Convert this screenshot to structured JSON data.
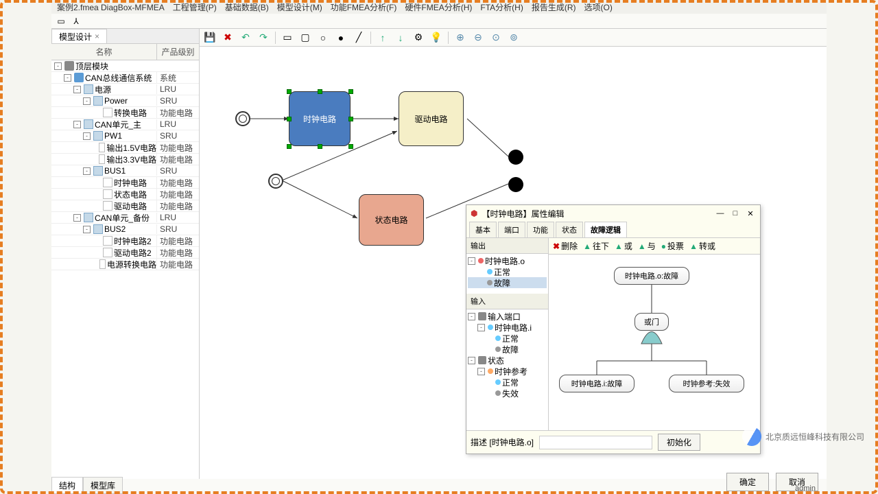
{
  "title_fragment": "案例2.fmea   DiagBox-MFMEA",
  "menus": [
    "工程管理(P)",
    "基础数据(B)",
    "模型设计(M)",
    "功能FMEA分析(F)",
    "硬件FMEA分析(H)",
    "FTA分析(H)",
    "报告生成(R)",
    "选项(O)"
  ],
  "model_tab": "模型设计",
  "tree_headers": {
    "name": "名称",
    "level": "产品级别"
  },
  "tree": [
    {
      "pad": 4,
      "exp": "-",
      "icon": "mod",
      "label": "顶层模块",
      "level": ""
    },
    {
      "pad": 18,
      "exp": "-",
      "icon": "plus",
      "label": "CAN总线通信系统",
      "level": "系统"
    },
    {
      "pad": 32,
      "exp": "-",
      "icon": "fold",
      "label": "电源",
      "level": "LRU"
    },
    {
      "pad": 46,
      "exp": "-",
      "icon": "fold",
      "label": "Power",
      "level": "SRU"
    },
    {
      "pad": 60,
      "exp": "",
      "icon": "file",
      "label": "转换电路",
      "level": "功能电路"
    },
    {
      "pad": 32,
      "exp": "-",
      "icon": "fold",
      "label": "CAN单元_主",
      "level": "LRU"
    },
    {
      "pad": 46,
      "exp": "-",
      "icon": "fold",
      "label": "PW1",
      "level": "SRU"
    },
    {
      "pad": 60,
      "exp": "",
      "icon": "file",
      "label": "输出1.5V电路",
      "level": "功能电路"
    },
    {
      "pad": 60,
      "exp": "",
      "icon": "file",
      "label": "输出3.3V电路",
      "level": "功能电路"
    },
    {
      "pad": 46,
      "exp": "-",
      "icon": "fold",
      "label": "BUS1",
      "level": "SRU"
    },
    {
      "pad": 60,
      "exp": "",
      "icon": "file",
      "label": "时钟电路",
      "level": "功能电路"
    },
    {
      "pad": 60,
      "exp": "",
      "icon": "file",
      "label": "状态电路",
      "level": "功能电路"
    },
    {
      "pad": 60,
      "exp": "",
      "icon": "file",
      "label": "驱动电路",
      "level": "功能电路"
    },
    {
      "pad": 32,
      "exp": "-",
      "icon": "fold",
      "label": "CAN单元_备份",
      "level": "LRU"
    },
    {
      "pad": 46,
      "exp": "-",
      "icon": "fold",
      "label": "BUS2",
      "level": "SRU"
    },
    {
      "pad": 60,
      "exp": "",
      "icon": "file",
      "label": "时钟电路2",
      "level": "功能电路"
    },
    {
      "pad": 60,
      "exp": "",
      "icon": "file",
      "label": "驱动电路2",
      "level": "功能电路"
    },
    {
      "pad": 60,
      "exp": "",
      "icon": "file",
      "label": "电源转换电路",
      "level": "功能电路"
    }
  ],
  "bottom_tabs": {
    "structure": "结构",
    "library": "模型库"
  },
  "canvas_nodes": {
    "clock": "时钟电路",
    "drive": "驱动电路",
    "state": "状态电路"
  },
  "dialog": {
    "title": "【时钟电路】属性编辑",
    "tabs": [
      "基本",
      "端口",
      "功能",
      "状态",
      "故障逻辑"
    ],
    "active_tab": 4,
    "sections": {
      "output": "输出",
      "output_root": "时钟电路.o",
      "output_children": [
        "正常",
        "故障"
      ],
      "input": "输入",
      "input_port": "输入端口",
      "input_root": "时钟电路.i",
      "input_children": [
        "正常",
        "故障"
      ],
      "state": "状态",
      "state_root": "时钟参考",
      "state_children": [
        "正常",
        "失效"
      ]
    },
    "toolbar": {
      "delete": "删除",
      "down": "往下",
      "or": "或",
      "and": "与",
      "vote": "投票",
      "transfer": "转或"
    },
    "fault_nodes": {
      "top": "时钟电路.o:故障",
      "gate": "或门",
      "left": "时钟电路.i:故障",
      "right": "时钟参考:失效"
    },
    "desc_label": "描述 [时钟电路.o]",
    "init_btn": "初始化"
  },
  "footer": {
    "ok": "确定",
    "cancel": "取消"
  },
  "status_user": "admin",
  "watermark": "北京质远恒峰科技有限公司"
}
